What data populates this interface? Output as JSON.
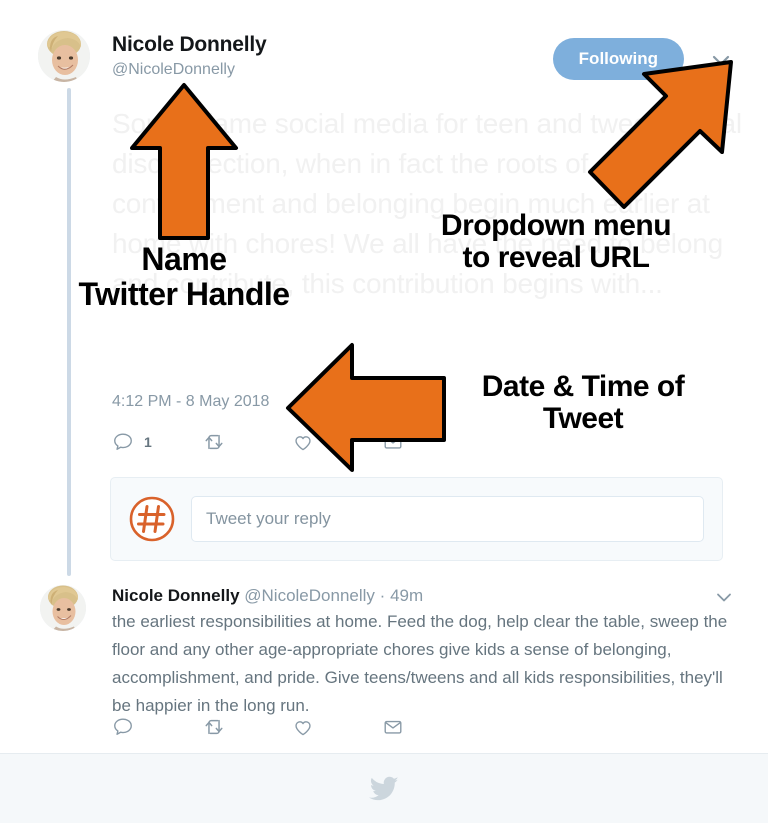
{
  "tweet": {
    "display_name": "Nicole Donnelly",
    "handle": "@NicoleDonnelly",
    "following_label": "Following",
    "body": "Some blame social media for teen and tween social disconnection, when in fact the roots of contentment and belonging begin much earlier at home with chores! We all have the need to belong and contribute, this contribution begins with...",
    "timestamp": "4:12 PM - 8 May 2018",
    "actions": {
      "reply_count": "1",
      "retweet_count": "",
      "like_count": "",
      "message_count": ""
    }
  },
  "composer": {
    "placeholder": "Tweet your reply",
    "value": ""
  },
  "reply": {
    "display_name": "Nicole Donnelly",
    "handle": "@NicoleDonnelly",
    "separator": "·",
    "time_ago": "49m",
    "body": "the earliest responsibilities at home. Feed the dog, help clear the table, sweep the floor and any other age-appropriate chores give kids a sense of belonging, accomplishment, and pride. Give teens/tweens and all kids responsibilities, they'll be happier in the long run."
  },
  "annotations": {
    "name": "Name",
    "twitter_handle": "Twitter Handle",
    "dropdown_line1": "Dropdown menu",
    "dropdown_line2": "to reveal URL",
    "datetime_line1": "Date & Time of",
    "datetime_line2": "Tweet"
  },
  "colors": {
    "annotation_arrow": "#e8701a",
    "annotation_arrow_outline": "#000000",
    "following_button": "#7eafdc",
    "thread_line": "#ccd9e6",
    "faded_tweet_text": "#f1f1f1",
    "muted_text": "#8899a6",
    "body_text": "#66757f",
    "footer_background": "#f5f8fa",
    "composer_background": "#f7fafc"
  },
  "icons": {
    "reply": "reply-icon",
    "retweet": "retweet-icon",
    "like": "heart-icon",
    "message": "envelope-icon",
    "caret": "chevron-down-icon",
    "footer_logo": "twitter-bird-icon",
    "composer_avatar": "hashtag-avatar-icon"
  }
}
